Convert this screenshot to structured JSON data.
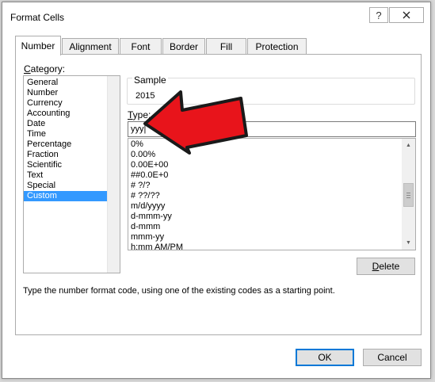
{
  "window": {
    "title": "Format Cells",
    "help_glyph": "?",
    "close_icon": "close-icon"
  },
  "tabs": [
    {
      "label": "Number",
      "active": true
    },
    {
      "label": "Alignment",
      "active": false
    },
    {
      "label": "Font",
      "active": false
    },
    {
      "label": "Border",
      "active": false
    },
    {
      "label": "Fill",
      "active": false
    },
    {
      "label": "Protection",
      "active": false
    }
  ],
  "category": {
    "label_access": "C",
    "label_rest": "ategory:",
    "items": [
      "General",
      "Number",
      "Currency",
      "Accounting",
      "Date",
      "Time",
      "Percentage",
      "Fraction",
      "Scientific",
      "Text",
      "Special",
      "Custom"
    ],
    "selected": "Custom"
  },
  "sample": {
    "legend": "Sample",
    "value": "2015"
  },
  "type": {
    "label_access": "T",
    "label_rest": "ype:",
    "value": "yyy|"
  },
  "formats": {
    "items": [
      "0%",
      "0.00%",
      "0.00E+00",
      "##0.0E+0",
      "# ?/?",
      "# ??/??",
      "m/d/yyyy",
      "d-mmm-yy",
      "d-mmm",
      "mmm-yy",
      "h:mm AM/PM"
    ]
  },
  "buttons": {
    "delete_access": "D",
    "delete_rest": "elete",
    "ok": "OK",
    "cancel": "Cancel"
  },
  "hint": "Type the number format code, using one of the existing codes as a starting point.",
  "colors": {
    "selection": "#3399ff",
    "annotation_arrow": "#e8141b",
    "default_button_border": "#0078d7"
  }
}
